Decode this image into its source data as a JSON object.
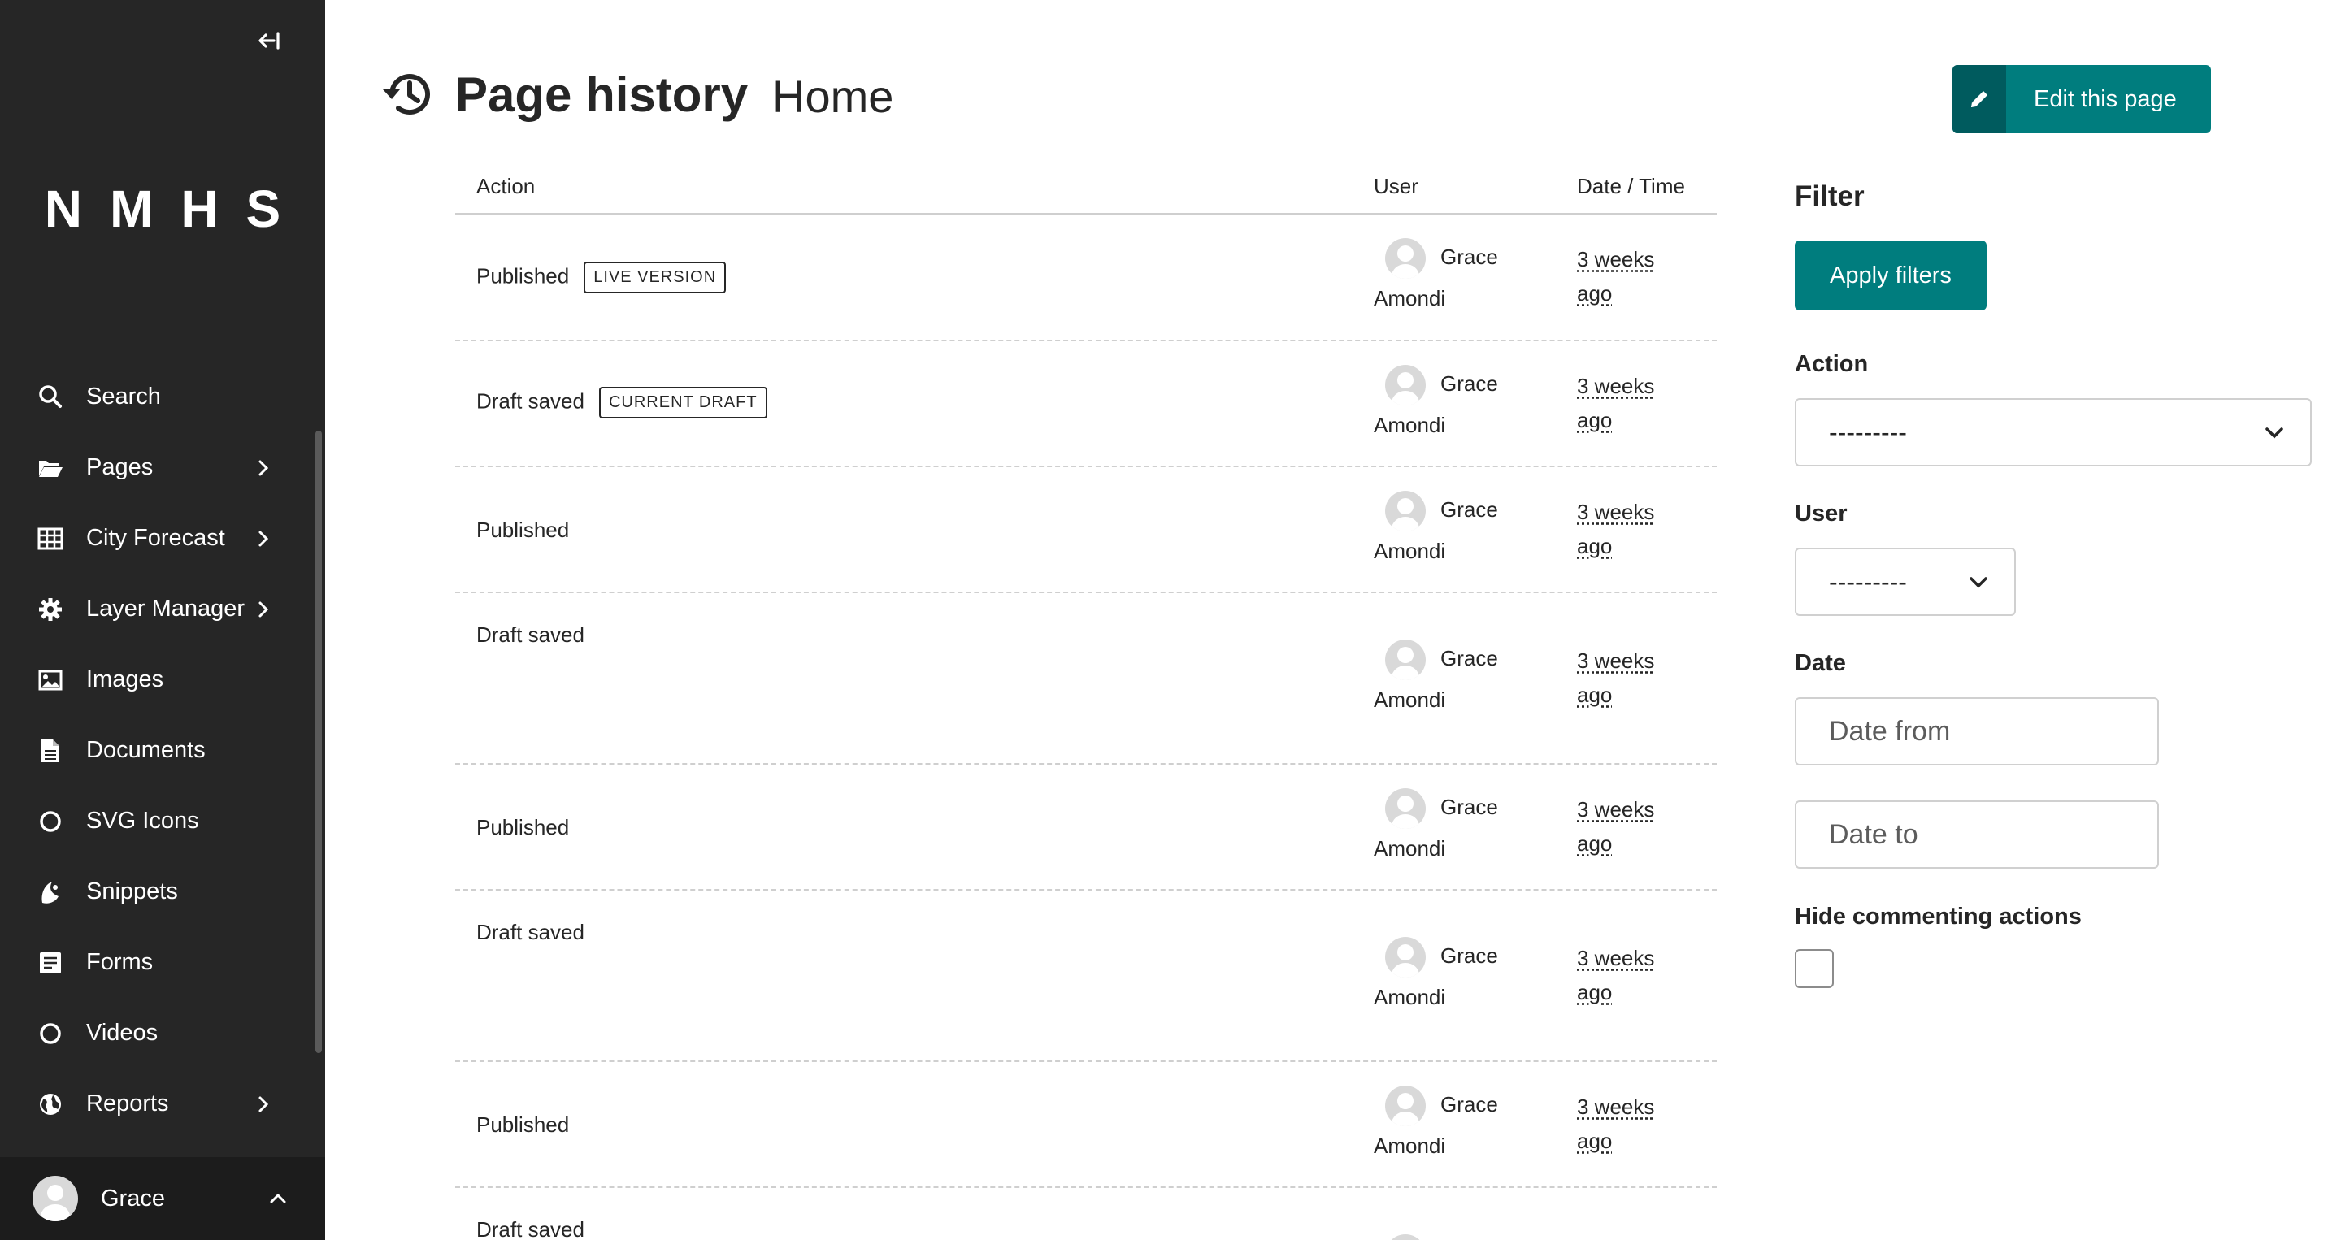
{
  "sidebar": {
    "logo": "NMHS",
    "collapse_icon": "collapse-sidebar-icon",
    "items": [
      {
        "label": "Search",
        "icon": "search-icon",
        "has_submenu": false
      },
      {
        "label": "Pages",
        "icon": "folder-open-icon",
        "has_submenu": true
      },
      {
        "label": "City Forecast",
        "icon": "table-icon",
        "has_submenu": true
      },
      {
        "label": "Layer Manager",
        "icon": "cog-icon",
        "has_submenu": true
      },
      {
        "label": "Images",
        "icon": "image-icon",
        "has_submenu": false
      },
      {
        "label": "Documents",
        "icon": "document-icon",
        "has_submenu": false
      },
      {
        "label": "SVG Icons",
        "icon": "circle-icon",
        "has_submenu": false
      },
      {
        "label": "Snippets",
        "icon": "snippet-icon",
        "has_submenu": false
      },
      {
        "label": "Forms",
        "icon": "form-icon",
        "has_submenu": false
      },
      {
        "label": "Videos",
        "icon": "circle-icon",
        "has_submenu": false
      },
      {
        "label": "Reports",
        "icon": "globe-icon",
        "has_submenu": true
      }
    ],
    "account": {
      "name": "Grace"
    }
  },
  "header": {
    "title": "Page history",
    "subtitle": "Home",
    "edit_button": "Edit this page"
  },
  "table": {
    "columns": {
      "action": "Action",
      "user": "User",
      "date": "Date / Time"
    },
    "rows": [
      {
        "action": "Published",
        "badge": "LIVE VERSION",
        "user_first": "Grace",
        "user_last": "Amondi",
        "date_1": "3 weeks",
        "date_2": "ago"
      },
      {
        "action": "Draft saved",
        "badge": "CURRENT DRAFT",
        "user_first": "Grace",
        "user_last": "Amondi",
        "date_1": "3 weeks",
        "date_2": "ago"
      },
      {
        "action": "Published",
        "badge": "",
        "user_first": "Grace",
        "user_last": "Amondi",
        "date_1": "3 weeks",
        "date_2": "ago"
      },
      {
        "action": "Draft saved",
        "badge": "",
        "user_first": "Grace",
        "user_last": "Amondi",
        "date_1": "3 weeks",
        "date_2": "ago"
      },
      {
        "action": "Published",
        "badge": "",
        "user_first": "Grace",
        "user_last": "Amondi",
        "date_1": "3 weeks",
        "date_2": "ago"
      },
      {
        "action": "Draft saved",
        "badge": "",
        "user_first": "Grace",
        "user_last": "Amondi",
        "date_1": "3 weeks",
        "date_2": "ago"
      },
      {
        "action": "Published",
        "badge": "",
        "user_first": "Grace",
        "user_last": "Amondi",
        "date_1": "3 weeks",
        "date_2": "ago"
      },
      {
        "action": "Draft saved",
        "badge": "",
        "user_first": "",
        "user_last": "",
        "date_1": "",
        "date_2": ""
      }
    ]
  },
  "filter": {
    "title": "Filter",
    "apply_button": "Apply filters",
    "action_label": "Action",
    "action_value": "---------",
    "user_label": "User",
    "user_value": "---------",
    "date_label": "Date",
    "date_from_placeholder": "Date from",
    "date_to_placeholder": "Date to",
    "hide_commenting_label": "Hide commenting actions"
  },
  "colors": {
    "sidebar_bg": "#262626",
    "primary": "#007d7e",
    "primary_dark": "#005b5e"
  }
}
